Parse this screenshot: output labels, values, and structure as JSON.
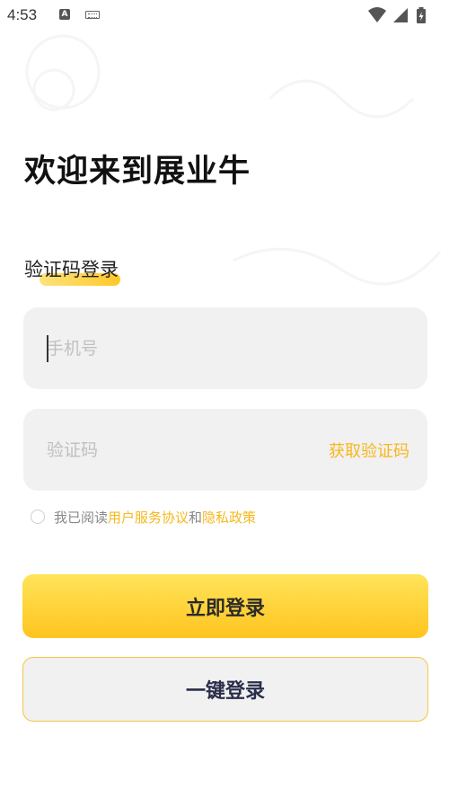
{
  "status_bar": {
    "time": "4:53",
    "a_badge": "A",
    "icons": [
      "notification-a-icon",
      "keyboard-icon",
      "wifi-icon",
      "signal-icon",
      "battery-charging-icon"
    ]
  },
  "page": {
    "title": "欢迎来到展业牛",
    "section_label": "验证码登录"
  },
  "form": {
    "phone_placeholder": "手机号",
    "code_placeholder": "验证码",
    "get_code_label": "获取验证码"
  },
  "agreement": {
    "prefix": "我已阅读",
    "user_agreement": "用户服务协议",
    "conjunction": "和",
    "privacy_policy": "隐私政策",
    "checked": false
  },
  "buttons": {
    "login": "立即登录",
    "one_key_login": "一键登录"
  },
  "colors": {
    "accent": "#f6b81d",
    "login_gradient_top": "#ffe45a",
    "login_gradient_bottom": "#ffc41f",
    "field_bg": "#f1f1f1",
    "one_key_text": "#2b2e4a"
  }
}
